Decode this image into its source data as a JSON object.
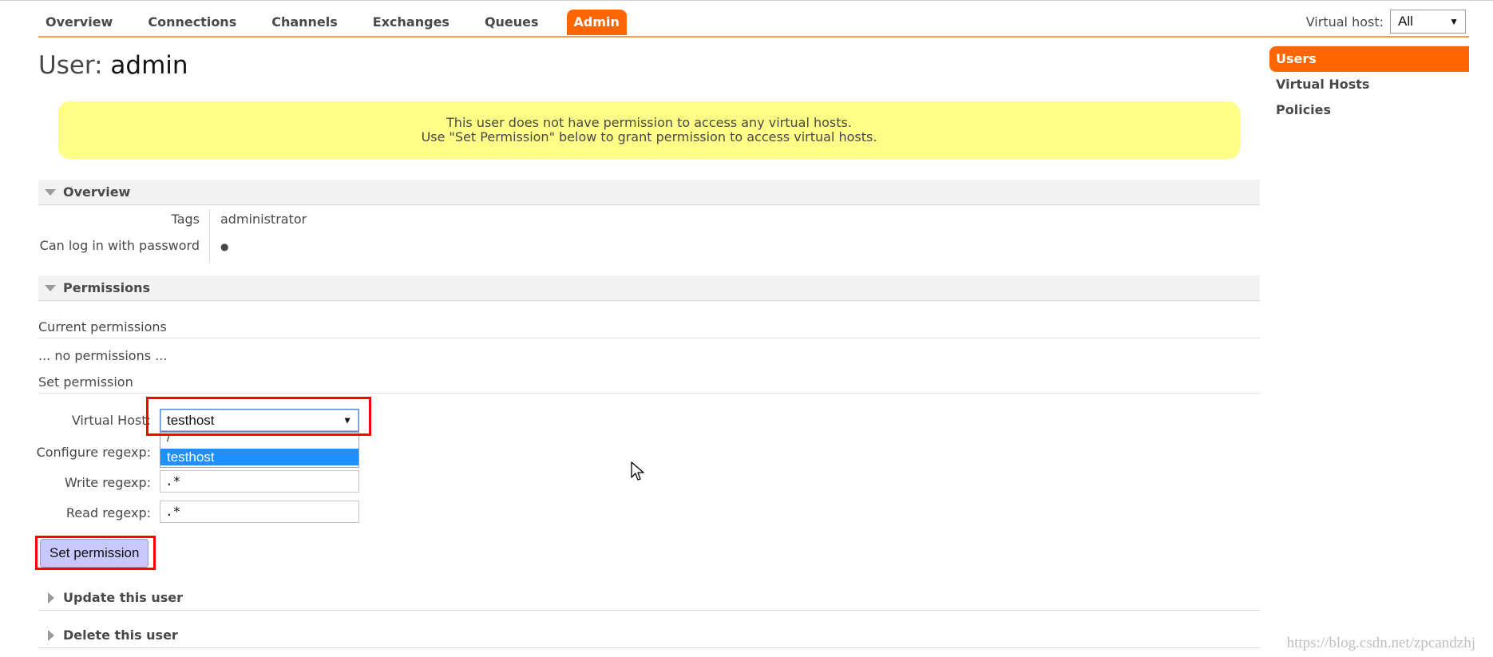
{
  "nav": {
    "tabs": [
      {
        "label": "Overview"
      },
      {
        "label": "Connections"
      },
      {
        "label": "Channels"
      },
      {
        "label": "Exchanges"
      },
      {
        "label": "Queues"
      },
      {
        "label": "Admin",
        "active": true
      }
    ],
    "virtual_host_label": "Virtual host:",
    "virtual_host_value": "All"
  },
  "sidebar": {
    "items": [
      {
        "label": "Users",
        "active": true
      },
      {
        "label": "Virtual Hosts"
      },
      {
        "label": "Policies"
      }
    ]
  },
  "page": {
    "title_prefix": "User:",
    "title_name": "admin"
  },
  "warning": {
    "line1": "This user does not have permission to access any virtual hosts.",
    "line2": "Use \"Set Permission\" below to grant permission to access virtual hosts."
  },
  "overview": {
    "header": "Overview",
    "tags_label": "Tags",
    "tags_value": "administrator",
    "login_label": "Can log in with password",
    "login_value": "●"
  },
  "permissions": {
    "header": "Permissions",
    "current_label": "Current permissions",
    "none_text": "... no permissions ...",
    "set_label": "Set permission",
    "form": {
      "vhost_label": "Virtual Host:",
      "vhost_value": "testhost",
      "vhost_options": [
        "/",
        "testhost"
      ],
      "configure_label": "Configure regexp:",
      "write_label": "Write regexp:",
      "write_value": ".*",
      "read_label": "Read regexp:",
      "read_value": ".*"
    },
    "submit_label": "Set permission"
  },
  "sections": {
    "update_label": "Update this user",
    "delete_label": "Delete this user"
  },
  "colors": {
    "accent": "#ff6600",
    "warning_bg": "#ffff88",
    "button_bg": "#c8c8ff",
    "highlight": "#ff0000",
    "option_selected": "#1e90ff"
  },
  "watermark": "https://blog.csdn.net/zpcandzhj"
}
